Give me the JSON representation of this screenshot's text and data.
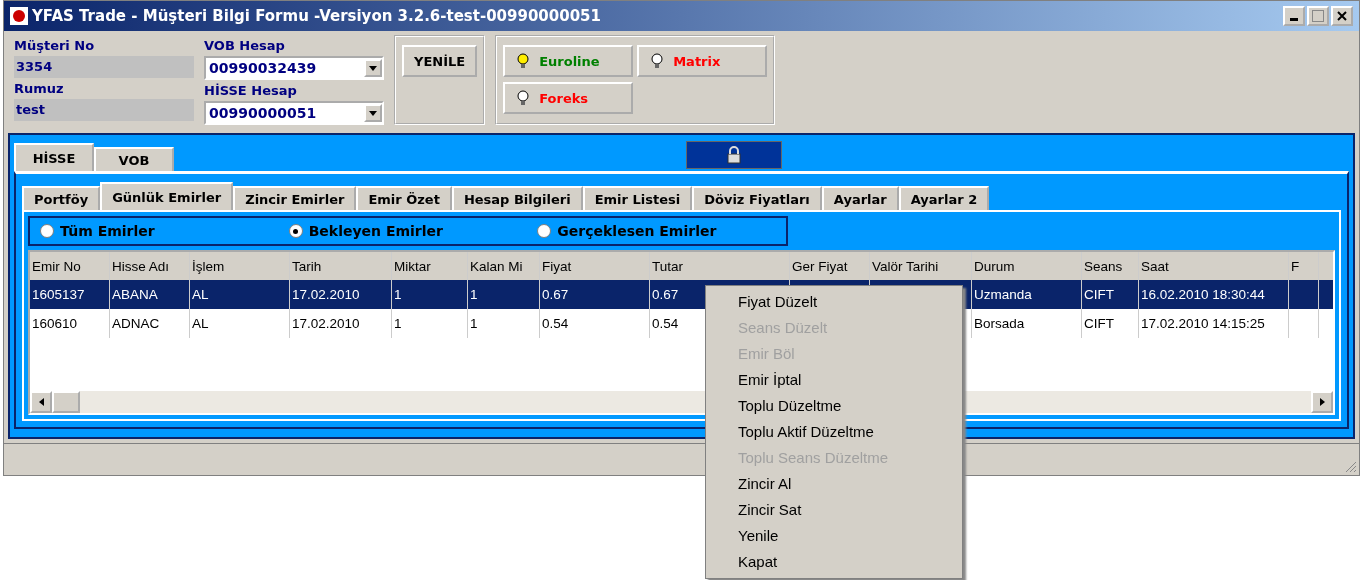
{
  "window": {
    "title": "YFAS Trade - Müşteri Bilgi Formu -Versiyon 3.2.6-test-00990000051"
  },
  "customer": {
    "number_label": "Müşteri No",
    "number": "3354",
    "alias_label": "Rumuz",
    "alias": "test"
  },
  "accounts": [
    {
      "label": "VOB Hesap",
      "value": "00990032439"
    },
    {
      "label": "HİSSE Hesap",
      "value": "00990000051"
    }
  ],
  "refresh_button": "YENİLE",
  "connections": [
    {
      "label": "Euroline",
      "on": true,
      "color": "#008000"
    },
    {
      "label": "Matrix",
      "on": false,
      "color": "#ff0000"
    },
    {
      "label": "Foreks",
      "on": false,
      "color": "#ff0000"
    }
  ],
  "market_tabs": [
    {
      "label": "HİSSE",
      "selected": true
    },
    {
      "label": "VOB",
      "selected": false
    }
  ],
  "tabs": [
    {
      "label": "Portföy",
      "selected": false
    },
    {
      "label": "Günlük Emirler",
      "selected": true
    },
    {
      "label": "Zincir Emirler",
      "selected": false
    },
    {
      "label": "Emir Özet",
      "selected": false
    },
    {
      "label": "Hesap Bilgileri",
      "selected": false
    },
    {
      "label": "Emir Listesi",
      "selected": false
    },
    {
      "label": "Döviz Fiyatları",
      "selected": false
    },
    {
      "label": "Ayarlar",
      "selected": false
    },
    {
      "label": "Ayarlar 2",
      "selected": false
    }
  ],
  "filters": [
    {
      "label": "Tüm Emirler",
      "selected": false
    },
    {
      "label": "Bekleyen Emirler",
      "selected": true
    },
    {
      "label": "Gerçeklesen Emirler",
      "selected": false
    }
  ],
  "table": {
    "columns": [
      "Emir No",
      "Hisse Adı",
      "İşlem",
      "Tarih",
      "Miktar",
      "Kalan Mi",
      "Fiyat",
      "Tutar",
      "Ger Fiyat",
      "Valör Tarihi",
      "Durum",
      "Seans",
      "Saat",
      "F"
    ],
    "rows": [
      {
        "selected": true,
        "cells": [
          "1605137",
          "ABANA",
          "AL",
          "17.02.2010",
          "1",
          "1",
          "0.67",
          "0.67",
          null,
          null,
          "Uzmanda",
          "CIFT",
          "16.02.2010 18:30:44",
          null
        ]
      },
      {
        "selected": false,
        "cells": [
          "160610",
          "ADNAC",
          "AL",
          "17.02.2010",
          "1",
          "1",
          "0.54",
          "0.54",
          null,
          null,
          "Borsada",
          "CIFT",
          "17.02.2010 14:15:25",
          null
        ]
      }
    ]
  },
  "context_menu": [
    {
      "label": "Fiyat Düzelt",
      "disabled": false
    },
    {
      "label": "Seans Düzelt",
      "disabled": true
    },
    {
      "label": "Emir Böl",
      "disabled": true
    },
    {
      "label": "Emir İptal",
      "disabled": false
    },
    {
      "label": "Toplu Düzeltme",
      "disabled": false
    },
    {
      "label": "Toplu Aktif Düzeltme",
      "disabled": false
    },
    {
      "label": "Toplu Seans Düzeltme",
      "disabled": true
    },
    {
      "label": "Zincir Al",
      "disabled": false
    },
    {
      "label": "Zincir Sat",
      "disabled": false
    },
    {
      "label": "Yenile",
      "disabled": false
    },
    {
      "label": "Kapat",
      "disabled": false
    }
  ]
}
